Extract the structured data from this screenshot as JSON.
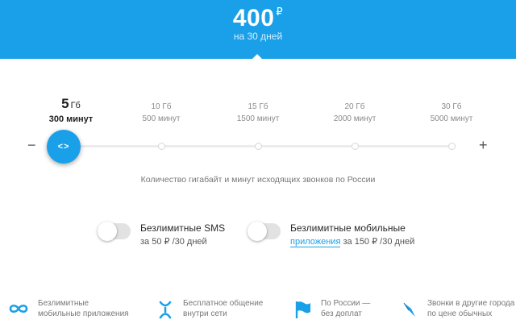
{
  "header": {
    "price": "400",
    "currency": "₽",
    "period": "на 30 дней"
  },
  "slider": {
    "options": [
      {
        "gb": "5",
        "gb_unit": "Гб",
        "minutes": "300 минут",
        "active": true
      },
      {
        "gb": "10 Гб",
        "minutes": "500 минут",
        "active": false
      },
      {
        "gb": "15 Гб",
        "minutes": "1500 минут",
        "active": false
      },
      {
        "gb": "20 Гб",
        "minutes": "2000 минут",
        "active": false
      },
      {
        "gb": "30 Гб",
        "minutes": "5000 минут",
        "active": false
      }
    ],
    "selected_index": 0,
    "minus": "−",
    "plus": "+",
    "knob_label": "<>",
    "caption": "Количество гигабайт и минут исходящих звонков по России"
  },
  "toggles": [
    {
      "title": "Безлимитные SMS",
      "subtitle": "за 50 ₽ /30 дней",
      "enabled": false
    },
    {
      "title": "Безлимитные мобильные",
      "subtitle_link": "приложения",
      "subtitle_rest": " за 150 ₽ /30 дней",
      "enabled": false
    }
  ],
  "features": [
    {
      "icon": "infinity-icon",
      "line1": "Безлимитные",
      "line2": "мобильные приложения"
    },
    {
      "icon": "tele2-network-icon",
      "line1": "Бесплатное общение",
      "line2": "внутри сети"
    },
    {
      "icon": "flag-icon",
      "line1": "По России —",
      "line2": "без доплат"
    },
    {
      "icon": "compass-icon",
      "line1": "Звонки в другие города",
      "line2": "по цене обычных"
    }
  ],
  "colors": {
    "accent": "#1aa0e8",
    "toggle_off": "#e2e2e2"
  }
}
